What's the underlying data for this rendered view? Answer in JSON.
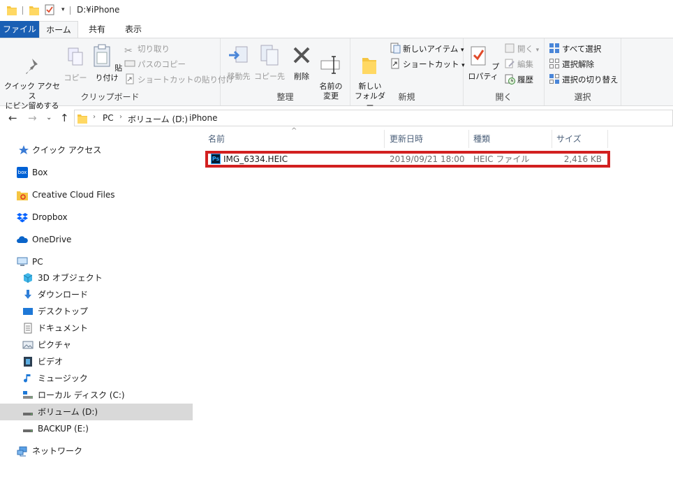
{
  "window": {
    "title": "D:¥iPhone"
  },
  "tabs": {
    "file": "ファイル",
    "home": "ホーム",
    "share": "共有",
    "view": "表示"
  },
  "ribbon": {
    "clipboard": {
      "label": "クリップボード",
      "pin": "クイック アクセス\nにピン留めする",
      "copy": "コピー",
      "paste": "貼り付け",
      "cut": "切り取り",
      "copy_path": "パスのコピー",
      "paste_shortcut": "ショートカットの貼り付け"
    },
    "organize": {
      "label": "整理",
      "move_to": "移動先",
      "copy_to": "コピー先",
      "delete": "削除",
      "rename": "名前の\n変更"
    },
    "new": {
      "label": "新規",
      "new_folder": "新しい\nフォルダー",
      "new_item": "新しいアイテム",
      "easy_access": "ショートカット"
    },
    "open": {
      "label": "開く",
      "properties": "プロパティ",
      "open": "開く",
      "edit": "編集",
      "history": "履歴"
    },
    "select": {
      "label": "選択",
      "select_all": "すべて選択",
      "select_none": "選択解除",
      "invert": "選択の切り替え"
    }
  },
  "address": {
    "crumbs": [
      "PC",
      "ボリューム (D:)",
      "iPhone"
    ]
  },
  "sidebar": {
    "items": [
      {
        "label": "クイック アクセス",
        "icon": "star-icon"
      },
      {
        "label": "Box",
        "icon": "box-icon"
      },
      {
        "label": "Creative Cloud Files",
        "icon": "creative-cloud-icon"
      },
      {
        "label": "Dropbox",
        "icon": "dropbox-icon"
      },
      {
        "label": "OneDrive",
        "icon": "onedrive-icon"
      },
      {
        "label": "PC",
        "icon": "pc-icon"
      },
      {
        "label": "3D オブジェクト",
        "icon": "3d-objects-icon"
      },
      {
        "label": "ダウンロード",
        "icon": "download-icon"
      },
      {
        "label": "デスクトップ",
        "icon": "desktop-icon"
      },
      {
        "label": "ドキュメント",
        "icon": "document-icon"
      },
      {
        "label": "ピクチャ",
        "icon": "pictures-icon"
      },
      {
        "label": "ビデオ",
        "icon": "video-icon"
      },
      {
        "label": "ミュージック",
        "icon": "music-icon"
      },
      {
        "label": "ローカル ディスク (C:)",
        "icon": "local-disk-icon"
      },
      {
        "label": "ボリューム (D:)",
        "icon": "drive-icon"
      },
      {
        "label": "BACKUP (E:)",
        "icon": "drive-icon"
      },
      {
        "label": "ネットワーク",
        "icon": "network-icon"
      }
    ]
  },
  "columns": {
    "name": "名前",
    "date": "更新日時",
    "type": "種類",
    "size": "サイズ"
  },
  "files": [
    {
      "name": "IMG_6334.HEIC",
      "date": "2019/09/21 18:00",
      "type": "HEIC ファイル",
      "size": "2,416 KB",
      "icon": "photoshop-icon"
    }
  ],
  "colors": {
    "file_tab": "#1a5fb4",
    "highlight_border": "#d22020",
    "selected_row": "#d9d9d9"
  }
}
